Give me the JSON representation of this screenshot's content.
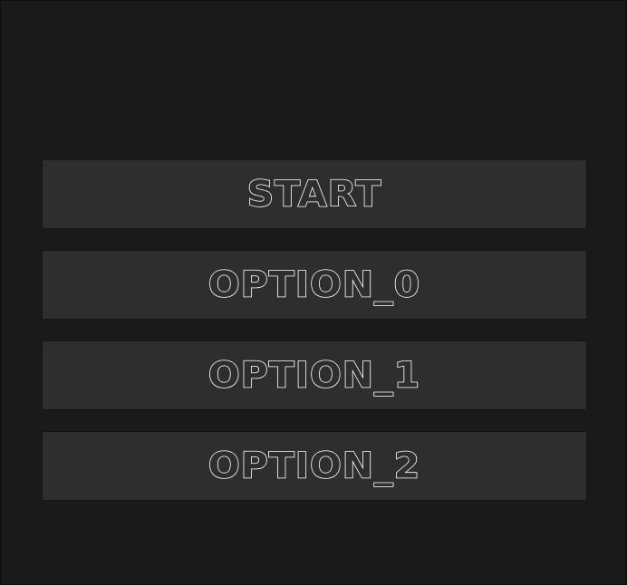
{
  "menu": {
    "items": [
      {
        "label": "START"
      },
      {
        "label": "OPTION_0"
      },
      {
        "label": "OPTION_1"
      },
      {
        "label": "OPTION_2"
      }
    ]
  },
  "colors": {
    "background": "#1a1a1a",
    "button_fill": "#2e2e2e",
    "text_outline": "#ffffff"
  }
}
